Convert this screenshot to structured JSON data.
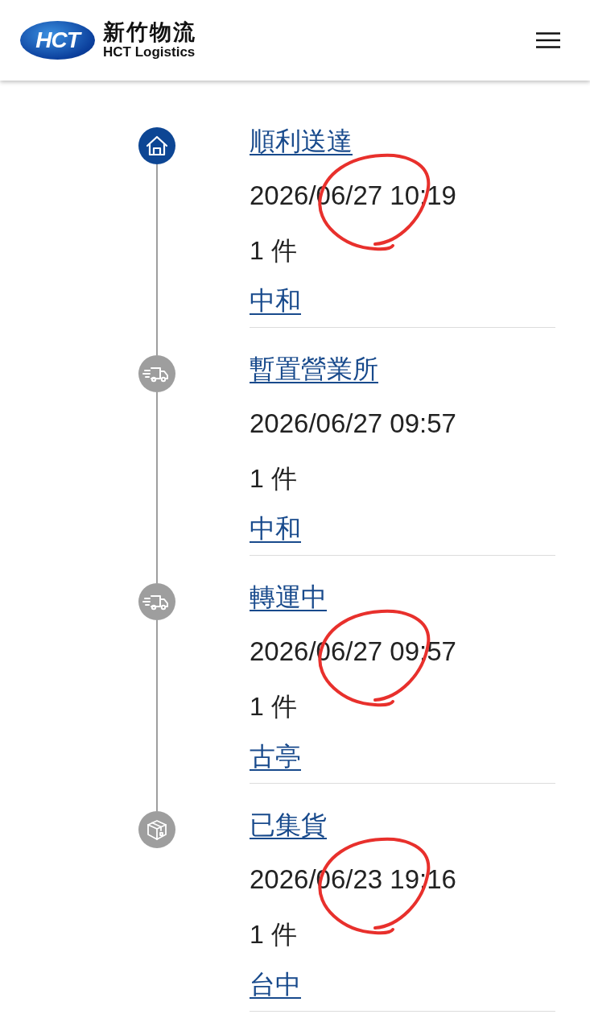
{
  "header": {
    "logo_text": "HCT",
    "brand_name": "新竹物流",
    "brand_subtitle": "HCT Logistics"
  },
  "events": [
    {
      "kind": "delivered",
      "current": true,
      "status": "順利送達",
      "time": "2026/06/27 10:19",
      "quantity": "1 件",
      "location": "中和",
      "circled": true
    },
    {
      "kind": "transit",
      "current": false,
      "status": "暫置營業所",
      "time": "2026/06/27 09:57",
      "quantity": "1 件",
      "location": "中和",
      "circled": false
    },
    {
      "kind": "transit",
      "current": false,
      "status": "轉運中",
      "time": "2026/06/27 09:57",
      "quantity": "1 件",
      "location": "古亭",
      "circled": true
    },
    {
      "kind": "collected",
      "current": false,
      "status": "已集貨",
      "time": "2026/06/23 19:16",
      "quantity": "1 件",
      "location": "台中",
      "circled": true
    }
  ]
}
